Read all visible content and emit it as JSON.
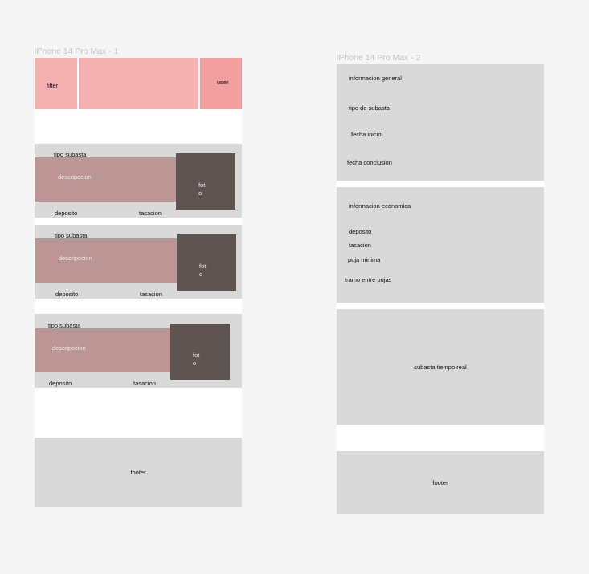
{
  "frames": [
    {
      "title": "iPhone 14 Pro Max - 1",
      "header": {
        "filter": "filter",
        "user": "user"
      },
      "cards": [
        {
          "type": "tipo subasta",
          "description": "descripccion",
          "photo_line1": "fot",
          "photo_line2": "o",
          "deposit": "deposito",
          "valuation": "tasacion"
        },
        {
          "type": "tipo subasta",
          "description": "descripccion",
          "photo_line1": "fot",
          "photo_line2": "o",
          "deposit": "deposito",
          "valuation": "tasacion"
        },
        {
          "type": "tipo subasta",
          "description": "descripccion",
          "photo_line1": "fot",
          "photo_line2": "o",
          "deposit": "deposito",
          "valuation": "tasacion"
        }
      ],
      "footer": "footer"
    },
    {
      "title": "iPhone 14 Pro Max - 2",
      "general": {
        "title": "informacion general",
        "auction_type": "tipo de subasta",
        "start_date": "fecha inicio",
        "end_date": "fecha conclusion"
      },
      "economic": {
        "title": "informacion economica",
        "deposit": "deposito",
        "valuation": "tasacion",
        "min_bid": "puja minima",
        "bid_step": "tramo entre pujas"
      },
      "realtime": "subasta tiempo real",
      "footer": "footer"
    }
  ]
}
